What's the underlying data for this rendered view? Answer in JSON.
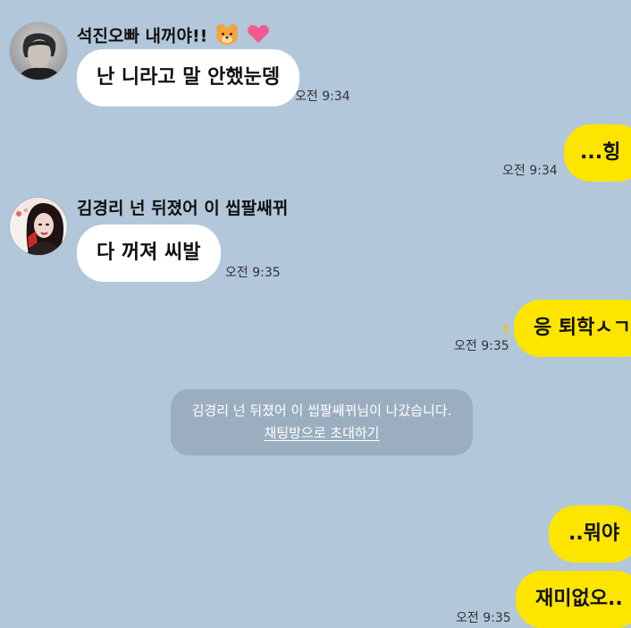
{
  "messages": [
    {
      "type": "incoming",
      "sender": "석진오빠 내꺼야!!",
      "sender_emojis": [
        "bear-face-icon",
        "heart-icon"
      ],
      "text": "난 니라고 말 안했눈뎅",
      "time": "오전 9:34"
    },
    {
      "type": "outgoing",
      "text": "...힝",
      "time": "오전 9:34"
    },
    {
      "type": "incoming",
      "sender": "김경리 넌 뒤졌어 이 씹팔쌔뀌",
      "text": "다 꺼져 씨발",
      "time": "오전 9:35"
    },
    {
      "type": "outgoing",
      "text": "응 퇴학ㅅㄱ",
      "unread": "1",
      "time": "오전 9:35"
    },
    {
      "type": "system",
      "text": "김경리 넌 뒤졌어 이 씹팔쌔뀌님이 나갔습니다.",
      "link": "채팅방으로 초대하기"
    },
    {
      "type": "outgoing",
      "text": "..뭐야"
    },
    {
      "type": "outgoing",
      "text": "재미없오..",
      "time": "오전 9:35"
    }
  ],
  "colors": {
    "background": "#b2c7da",
    "outgoing_bubble": "#fee500",
    "incoming_bubble": "#ffffff",
    "heart": "#ef5b8f",
    "bear": "#f2a23a"
  }
}
